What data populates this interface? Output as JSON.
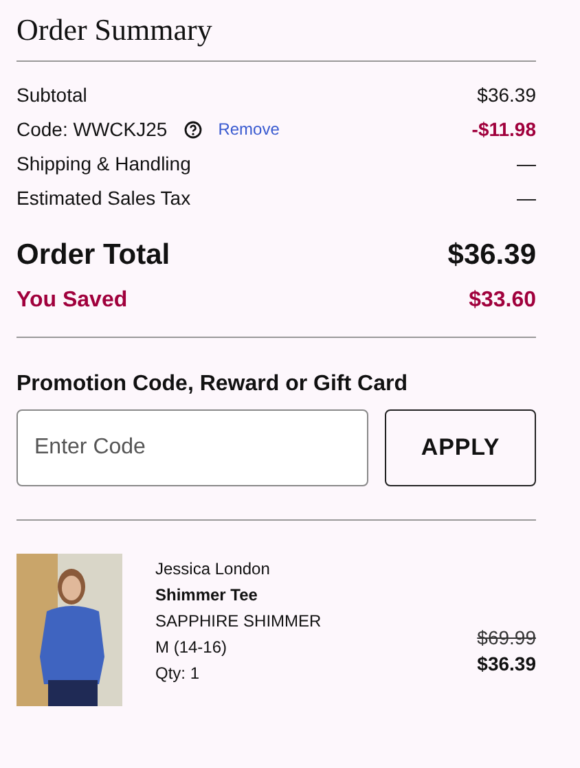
{
  "title": "Order Summary",
  "lines": [
    {
      "kind": "plain",
      "label": "Subtotal",
      "value": "$36.39"
    },
    {
      "kind": "code",
      "label": "Code: WWCKJ25",
      "link": "Remove",
      "value": "-$11.98"
    },
    {
      "kind": "plain",
      "label": "Shipping & Handling",
      "value": "—"
    },
    {
      "kind": "plain",
      "label": "Estimated Sales Tax",
      "value": "—"
    }
  ],
  "total": {
    "label": "Order Total",
    "value": "$36.39"
  },
  "saved": {
    "label": "You Saved",
    "value": "$33.60"
  },
  "promo": {
    "heading": "Promotion Code, Reward or Gift Card",
    "placeholder": "Enter Code",
    "button": "APPLY"
  },
  "item": {
    "brand": "Jessica London",
    "name": "Shimmer Tee",
    "shade_name": "SAPPHIRE SHIMMER",
    "size": "M (14-16)",
    "qty": "Qty: 1",
    "original_price": "$69.99",
    "price": "$36.39"
  }
}
